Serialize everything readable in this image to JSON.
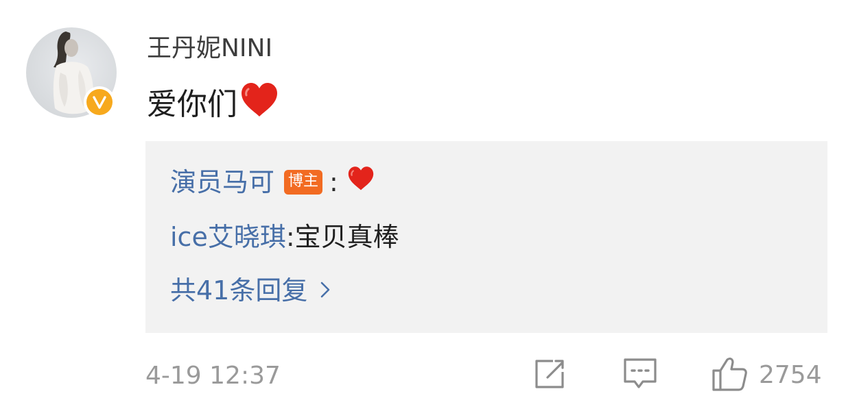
{
  "comment": {
    "username": "王丹妮NINI",
    "text": "爱你们",
    "text_emoji": "heart-emoji",
    "timestamp": "4-19 12:37",
    "like_count": "2754"
  },
  "replies": {
    "items": [
      {
        "name": "演员马可",
        "badge": "博主",
        "colon": ":",
        "message": "",
        "emoji": "heart-emoji"
      },
      {
        "name": "ice艾晓琪",
        "badge": "",
        "colon": ": ",
        "message": "宝贝真棒",
        "emoji": ""
      }
    ],
    "more_label": "共41条回复"
  },
  "icons": {
    "verified": "verified-v-icon",
    "share": "share-icon",
    "comment": "comment-icon",
    "like": "thumbs-up-icon",
    "more": "chevron-right-icon"
  },
  "colors": {
    "link": "#476fa8",
    "badge_bg": "#f26b22",
    "verified": "#f7a91d",
    "heart": "#e3241b",
    "reply_bg": "#f2f2f2",
    "meta": "#9a9a9a"
  }
}
